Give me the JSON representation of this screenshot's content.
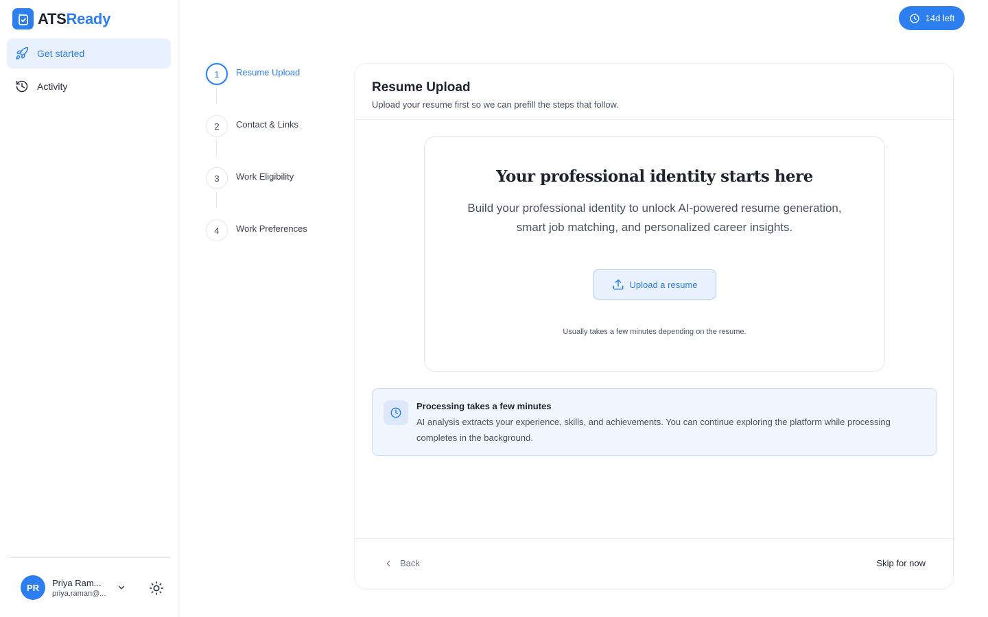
{
  "brand": {
    "name_part1": "ATS",
    "name_part2": "Ready",
    "accent_color": "#2d7ff0"
  },
  "sidebar": {
    "items": [
      {
        "label": "Get started",
        "icon": "rocket-icon",
        "active": true
      },
      {
        "label": "Activity",
        "icon": "history-icon",
        "active": false
      }
    ]
  },
  "user": {
    "initials": "PR",
    "name": "Priya Ram...",
    "email": "priya.raman@..."
  },
  "trial": {
    "label": "14d left",
    "icon": "clock-icon"
  },
  "stepper": {
    "steps": [
      {
        "number": "1",
        "label": "Resume Upload",
        "active": true
      },
      {
        "number": "2",
        "label": "Contact & Links",
        "active": false
      },
      {
        "number": "3",
        "label": "Work Eligibility",
        "active": false
      },
      {
        "number": "4",
        "label": "Work Preferences",
        "active": false
      }
    ]
  },
  "card": {
    "title": "Resume Upload",
    "subtitle": "Upload your resume first so we can prefill the steps that follow."
  },
  "hero": {
    "title": "Your professional identity starts here",
    "description": "Build your professional identity to unlock AI-powered resume generation, smart job matching, and personalized career insights.",
    "upload_label": "Upload a resume",
    "note": "Usually takes a few minutes depending on the resume."
  },
  "info": {
    "title": "Processing takes a few minutes",
    "text": "AI analysis extracts your experience, skills, and achievements. You can continue exploring the platform while processing completes in the background."
  },
  "footer": {
    "back_label": "Back",
    "skip_label": "Skip for now"
  }
}
